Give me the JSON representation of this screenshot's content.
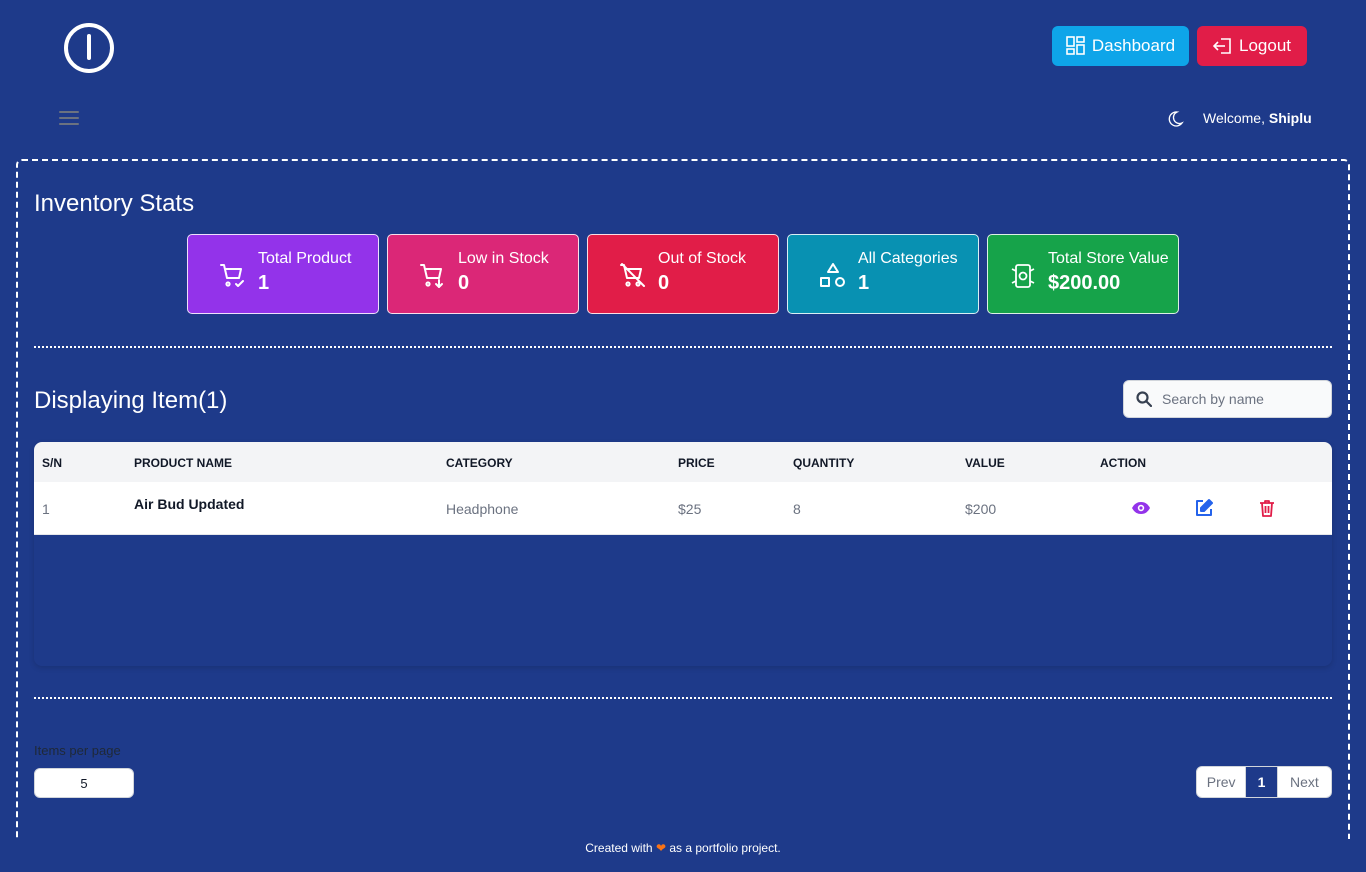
{
  "header": {
    "dashboard_label": "Dashboard",
    "logout_label": "Logout",
    "welcome_prefix": "Welcome,",
    "username": "Shiplu"
  },
  "stats": {
    "title": "Inventory Stats",
    "cards": [
      {
        "label": "Total Product",
        "value": "1",
        "color": "#9333ea",
        "icon": "cart-check-icon"
      },
      {
        "label": "Low in Stock",
        "value": "0",
        "color": "#db2777",
        "icon": "cart-down-icon"
      },
      {
        "label": "Out of Stock",
        "value": "0",
        "color": "#e11d48",
        "icon": "cart-off-icon"
      },
      {
        "label": "All Categories",
        "value": "1",
        "color": "#0891b2",
        "icon": "shapes-icon"
      },
      {
        "label": "Total Store Value",
        "value": "$200.00",
        "color": "#16a34a",
        "icon": "money-icon"
      }
    ]
  },
  "items": {
    "title": "Displaying Item(1)",
    "search_placeholder": "Search by name",
    "columns": [
      "S/N",
      "PRODUCT NAME",
      "CATEGORY",
      "PRICE",
      "QUANTITY",
      "VALUE",
      "ACTION"
    ],
    "rows": [
      {
        "sn": "1",
        "name": "Air Bud Updated",
        "category": "Headphone",
        "price": "$25",
        "quantity": "8",
        "value": "$200"
      }
    ]
  },
  "pagination": {
    "items_per_page_label": "Items per page",
    "items_per_page_value": "5",
    "prev_label": "Prev",
    "current_page": "1",
    "next_label": "Next"
  },
  "footer": {
    "text_before": "Created with",
    "text_after": "as a portfolio project."
  }
}
